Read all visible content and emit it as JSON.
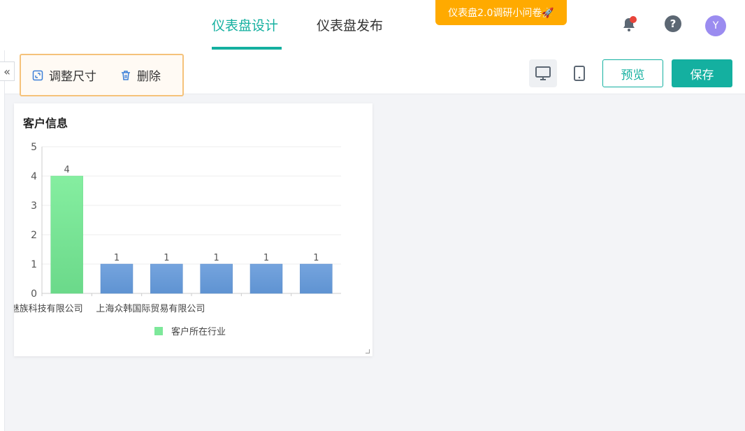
{
  "header": {
    "tabs": [
      {
        "label": "仪表盘设计",
        "active": true
      },
      {
        "label": "仪表盘发布",
        "active": false
      }
    ],
    "survey_label": "仪表盘2.0调研小问卷🚀",
    "help_label": "?",
    "avatar_label": "Y"
  },
  "sidebar": {
    "collapse_label": "«"
  },
  "toolbar": {
    "resize_label": "调整尺寸",
    "delete_label": "删除",
    "preview_label": "预览",
    "save_label": "保存"
  },
  "widget": {
    "title": "客户信息"
  },
  "colors": {
    "accent": "#14b0a0",
    "warning": "#ffaa00",
    "bar_highlight": "#7de89a",
    "bar": "#6a9bd8"
  },
  "chart_data": {
    "type": "bar",
    "categories": [
      "魅族科技有限公司",
      "",
      "上海众韩国际贸易有限公司",
      "",
      "",
      ""
    ],
    "tick_labels": [
      "魅族科技有限公司",
      "上海众韩国际贸易有限公司"
    ],
    "values": [
      4,
      1,
      1,
      1,
      1,
      1
    ],
    "data_labels": [
      "4",
      "1",
      "1",
      "1",
      "1",
      "1"
    ],
    "ylim": [
      0,
      5
    ],
    "yticks": [
      "0",
      "1",
      "2",
      "3",
      "4",
      "5"
    ],
    "legend": [
      "客户所在行业"
    ],
    "legend_position": "bottom",
    "grid": true
  }
}
